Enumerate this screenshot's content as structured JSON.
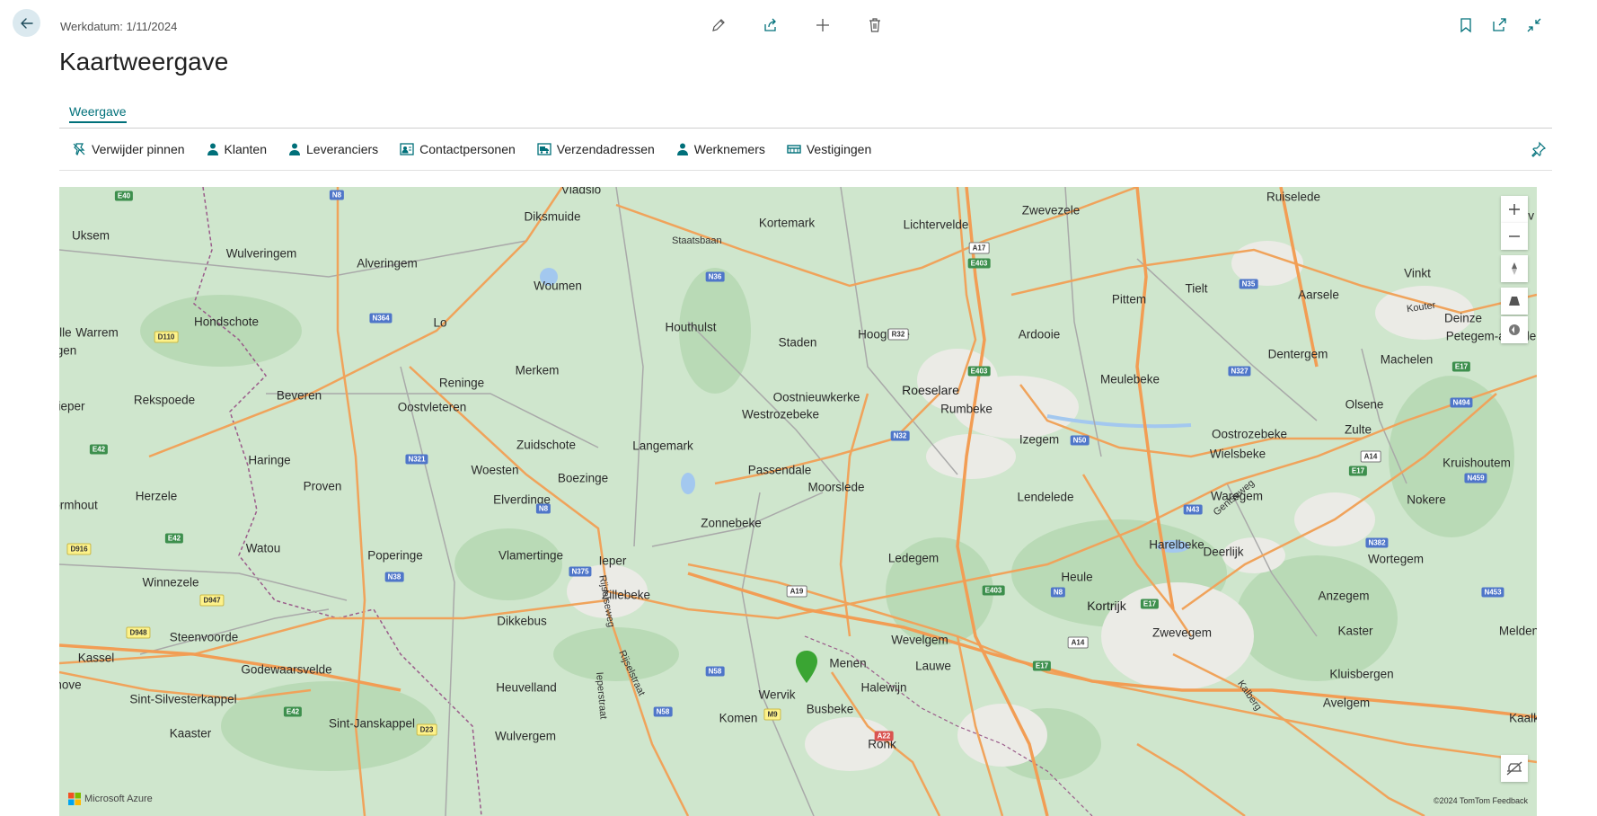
{
  "header": {
    "workdate": "Werkdatum: 1/11/2024",
    "title": "Kaartweergave",
    "tab_label": "Weergave"
  },
  "actions": [
    {
      "label": "Verwijder pinnen",
      "icon": "unpin-icon"
    },
    {
      "label": "Klanten",
      "icon": "person-icon"
    },
    {
      "label": "Leveranciers",
      "icon": "person-icon"
    },
    {
      "label": "Contactpersonen",
      "icon": "contact-card-icon"
    },
    {
      "label": "Verzendadressen",
      "icon": "truck-icon"
    },
    {
      "label": "Werknemers",
      "icon": "person-icon"
    },
    {
      "label": "Vestigingen",
      "icon": "building-icon"
    }
  ],
  "colors": {
    "accent": "#00707a",
    "map_green": "#cfe6cd",
    "highway": "#f0a35b",
    "marker": "#3aa533"
  },
  "map": {
    "towns": [
      {
        "name": "Vladslo"
      },
      {
        "name": "Diksmuide"
      },
      {
        "name": "Kortemark"
      },
      {
        "name": "Lichtervelde"
      },
      {
        "name": "Zwevezele"
      },
      {
        "name": "Ruiselede"
      },
      {
        "name": "Uksem"
      },
      {
        "name": "Wulveringem"
      },
      {
        "name": "Alveringem"
      },
      {
        "name": "Woumen"
      },
      {
        "name": "Staden"
      },
      {
        "name": "Hooglede"
      },
      {
        "name": "Ardooie"
      },
      {
        "name": "Pittem"
      },
      {
        "name": "Tielt"
      },
      {
        "name": "Aarsele"
      },
      {
        "name": "Vinkt"
      },
      {
        "name": "Warrem"
      },
      {
        "name": "Hondschote"
      },
      {
        "name": "Lo"
      },
      {
        "name": "Houthulst"
      },
      {
        "name": "Deinze"
      },
      {
        "name": "Petegem-aan-de"
      },
      {
        "name": "Dentergem"
      },
      {
        "name": "Machelen"
      },
      {
        "name": "Merkem"
      },
      {
        "name": "Reninge"
      },
      {
        "name": "Beveren"
      },
      {
        "name": "Rekspoede"
      },
      {
        "name": "Oostvleteren"
      },
      {
        "name": "Oostnieuwkerke"
      },
      {
        "name": "Roeselare"
      },
      {
        "name": "Rumbeke"
      },
      {
        "name": "Meulebeke"
      },
      {
        "name": "Olsene"
      },
      {
        "name": "Westrozebeke"
      },
      {
        "name": "Zulte"
      },
      {
        "name": "Oostrozebeke"
      },
      {
        "name": "Izegem"
      },
      {
        "name": "Zuidschote"
      },
      {
        "name": "Langemark"
      },
      {
        "name": "Haringe"
      },
      {
        "name": "Wielsbeke"
      },
      {
        "name": "Kruishoutem"
      },
      {
        "name": "Woesten"
      },
      {
        "name": "Passendale"
      },
      {
        "name": "Boezinge"
      },
      {
        "name": "Moorslede"
      },
      {
        "name": "Proven"
      },
      {
        "name": "Herzele"
      },
      {
        "name": "Elverdinge"
      },
      {
        "name": "Lendelede"
      },
      {
        "name": "Waregem"
      },
      {
        "name": "Nokere"
      },
      {
        "name": "Zonnebeke"
      },
      {
        "name": "Watou"
      },
      {
        "name": "Harelbeke"
      },
      {
        "name": "Deerlijk"
      },
      {
        "name": "Poperinge"
      },
      {
        "name": "Vlamertinge"
      },
      {
        "name": "Ieper"
      },
      {
        "name": "Ledegem"
      },
      {
        "name": "Wortegem"
      },
      {
        "name": "Heule"
      },
      {
        "name": "Winnezele"
      },
      {
        "name": "Zillebeke"
      },
      {
        "name": "Kortrijk"
      },
      {
        "name": "Anzegem"
      },
      {
        "name": "Dikkebus"
      },
      {
        "name": "Steenvoorde"
      },
      {
        "name": "Wevelgem"
      },
      {
        "name": "Zwevegem"
      },
      {
        "name": "Kaster"
      },
      {
        "name": "Melden"
      },
      {
        "name": "Kassel"
      },
      {
        "name": "Menen"
      },
      {
        "name": "Lauwe"
      },
      {
        "name": "Godewaarsvelde"
      },
      {
        "name": "Halewijn"
      },
      {
        "name": "Heuvelland"
      },
      {
        "name": "Kluisbergen"
      },
      {
        "name": "Wervik"
      },
      {
        "name": "Sint-Silvesterkappel"
      },
      {
        "name": "Busbeke"
      },
      {
        "name": "Avelgem"
      },
      {
        "name": "Komen"
      },
      {
        "name": "Sint-Janskappel"
      },
      {
        "name": "Kaalk"
      },
      {
        "name": "Kaaster"
      },
      {
        "name": "Wulvergem"
      },
      {
        "name": "Ronk"
      },
      {
        "name": "Ille"
      },
      {
        "name": "gen"
      },
      {
        "name": "lieper"
      },
      {
        "name": "ormhout"
      },
      {
        "name": "hove"
      },
      {
        "name": "Nev"
      }
    ],
    "shields": [
      "E40",
      "N8",
      "A17",
      "E403",
      "N36",
      "N35",
      "N364",
      "R32",
      "D110",
      "E403",
      "N327",
      "E17",
      "N494",
      "N32",
      "N50",
      "A14",
      "E17",
      "N321",
      "E42",
      "N459",
      "N8",
      "N43",
      "E42",
      "N382",
      "N375",
      "N38",
      "D916",
      "A19",
      "D947",
      "E403",
      "N8",
      "E17",
      "N453",
      "D948",
      "A14",
      "N58",
      "E17",
      "E42",
      "N58",
      "M9",
      "D23",
      "A22"
    ],
    "road_names": [
      "Staatsbaan",
      "Kouter",
      "Gentseweg",
      "Rijselseweg",
      "Rijselstraat",
      "Ieperstraat",
      "Kalberg"
    ],
    "marker_label": "Passendale",
    "attribution": "©2024 TomTom",
    "feedback": "Feedback",
    "logo": "Microsoft Azure"
  }
}
